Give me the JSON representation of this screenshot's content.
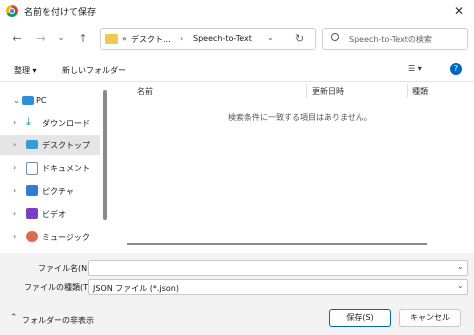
{
  "window": {
    "title": "名前を付けて保存",
    "close_glyph": "✕"
  },
  "nav": {
    "back": "←",
    "forward": "→",
    "recent": "⌄",
    "up": "↑",
    "refresh": "↻",
    "address_dropdown": "⌄"
  },
  "address": {
    "prefix": "«",
    "segments": [
      "デスクト...",
      "Speech-to-Text"
    ],
    "separator": "›"
  },
  "search": {
    "placeholder": "Speech-to-Textの検索"
  },
  "toolbar": {
    "organize_label": "整理 ▾",
    "new_folder_label": "新しいフォルダー",
    "view_glyph": "☰ ▾",
    "help_glyph": "?"
  },
  "sidebar": {
    "items": [
      {
        "label": "PC",
        "chevron": "⌄",
        "icon": "pc-icon"
      },
      {
        "label": "ダウンロード",
        "chevron": "›",
        "icon": "download-icon"
      },
      {
        "label": "デスクトップ",
        "chevron": "›",
        "icon": "desktop-icon",
        "selected": true
      },
      {
        "label": "ドキュメント",
        "chevron": "›",
        "icon": "document-icon"
      },
      {
        "label": "ピクチャ",
        "chevron": "›",
        "icon": "pictures-icon"
      },
      {
        "label": "ビデオ",
        "chevron": "›",
        "icon": "video-icon"
      },
      {
        "label": "ミュージック",
        "chevron": "›",
        "icon": "music-icon"
      }
    ]
  },
  "list": {
    "columns": [
      "名前",
      "更新日時",
      "種類"
    ],
    "empty_message": "検索条件に一致する項目はありません。"
  },
  "form": {
    "filename_label": "ファイル名(N):",
    "filename_value": "",
    "filetype_label": "ファイルの種類(T):",
    "filetype_value": "JSON ファイル (*.json)",
    "hide_folders_label": "フォルダーの非表示",
    "hide_glyph": "⌃",
    "save_label": "保存(S)",
    "cancel_label": "キャンセル"
  },
  "colors": {
    "accent": "#0067c0",
    "selected_bg": "#e5e5e5"
  }
}
